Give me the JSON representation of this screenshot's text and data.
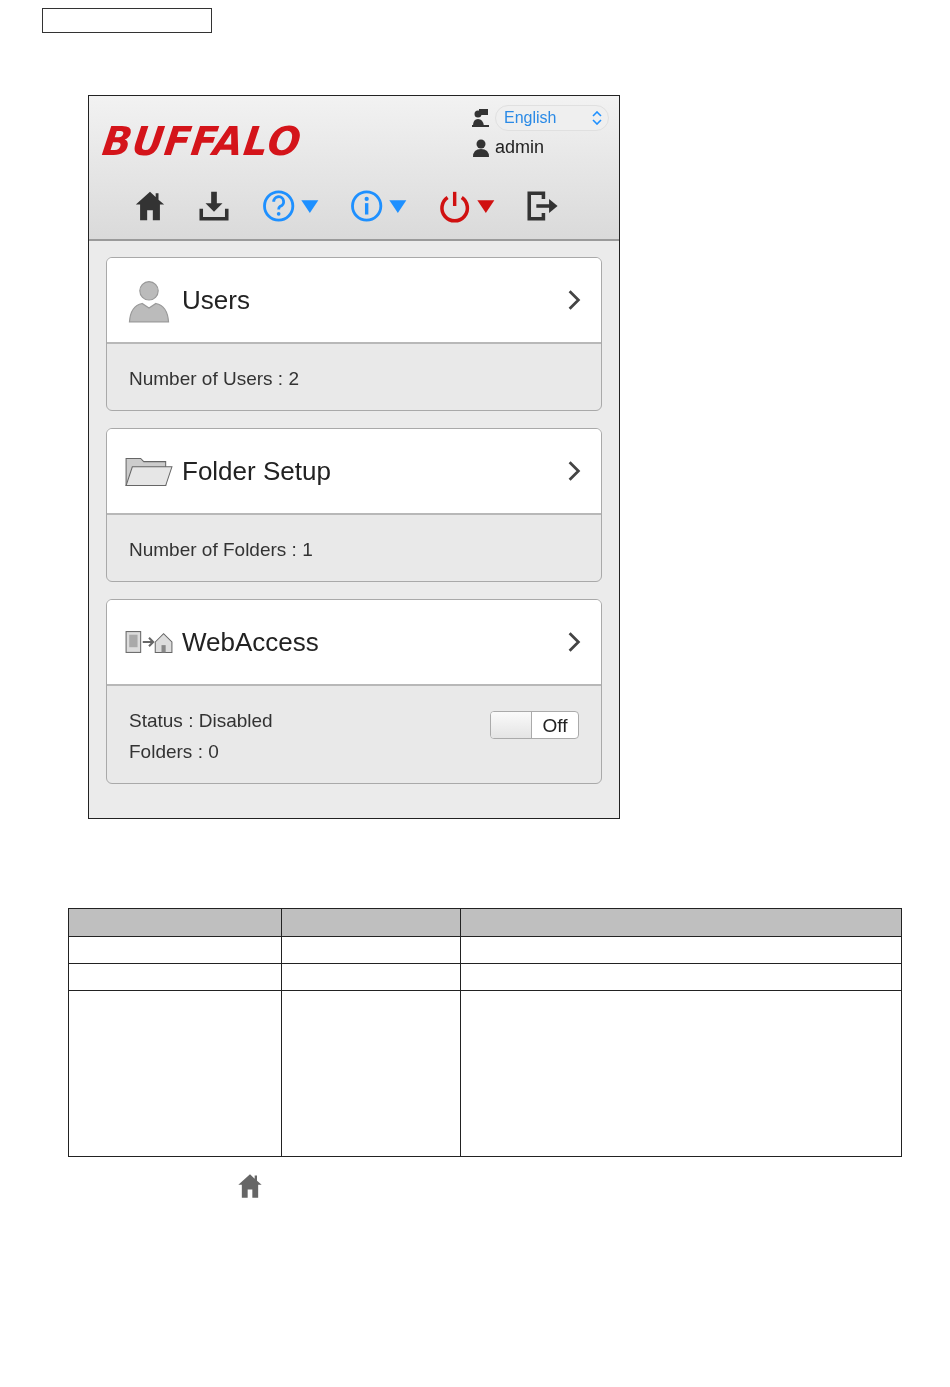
{
  "header": {
    "logo": "BUFFALO",
    "language": {
      "value": "English"
    },
    "user": "admin",
    "toolbar": [
      {
        "kind": "home"
      },
      {
        "kind": "download"
      },
      {
        "kind": "help"
      },
      {
        "kind": "info"
      },
      {
        "kind": "power"
      },
      {
        "kind": "logout"
      }
    ]
  },
  "cards": [
    {
      "kind": "users",
      "title": "Users",
      "lines": [
        "Number of Users : 2"
      ]
    },
    {
      "kind": "folder",
      "title": "Folder Setup",
      "lines": [
        "Number of Folders : 1"
      ]
    },
    {
      "kind": "webaccess",
      "title": "WebAccess",
      "lines": [
        "Status : Disabled",
        "Folders : 0"
      ],
      "toggle": {
        "on": false,
        "label": "Off"
      }
    }
  ]
}
